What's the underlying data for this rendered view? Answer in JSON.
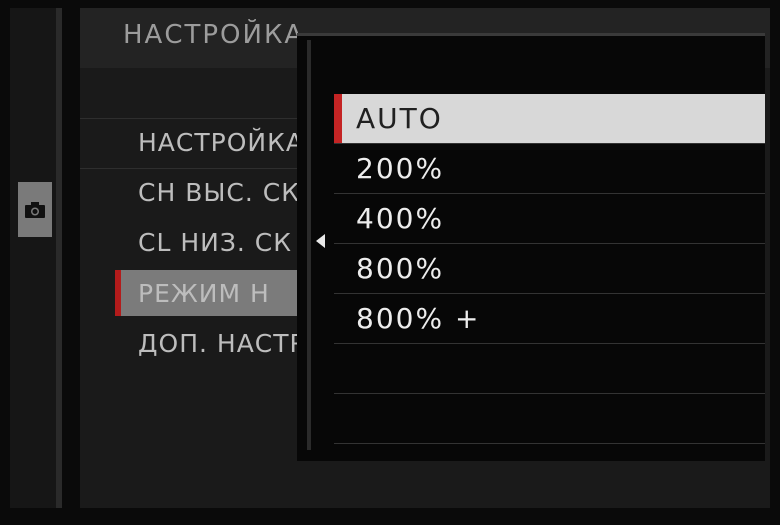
{
  "menu": {
    "title": "НАСТРОЙКА ПРИВОДА",
    "items": [
      {
        "label": "НАСТРОЙКА"
      },
      {
        "label": "CH ВЫС. СК"
      },
      {
        "label": "CL НИЗ. СК"
      },
      {
        "label": "РЕЖИМ Н"
      },
      {
        "label": "ДОП. НАСТР"
      }
    ],
    "selected_index": 3
  },
  "sidebar": {
    "active_tab_icon": "camera-icon"
  },
  "popup": {
    "options": [
      {
        "label": "AUTO"
      },
      {
        "label": "200%"
      },
      {
        "label": "400%"
      },
      {
        "label": "800%"
      },
      {
        "label": "800% +"
      }
    ],
    "selected_index": 0,
    "empty_rows": 2
  },
  "colors": {
    "accent": "#c42424",
    "selection_bg": "#d8d8d8",
    "base_selection_bg": "#7b7b7b"
  }
}
